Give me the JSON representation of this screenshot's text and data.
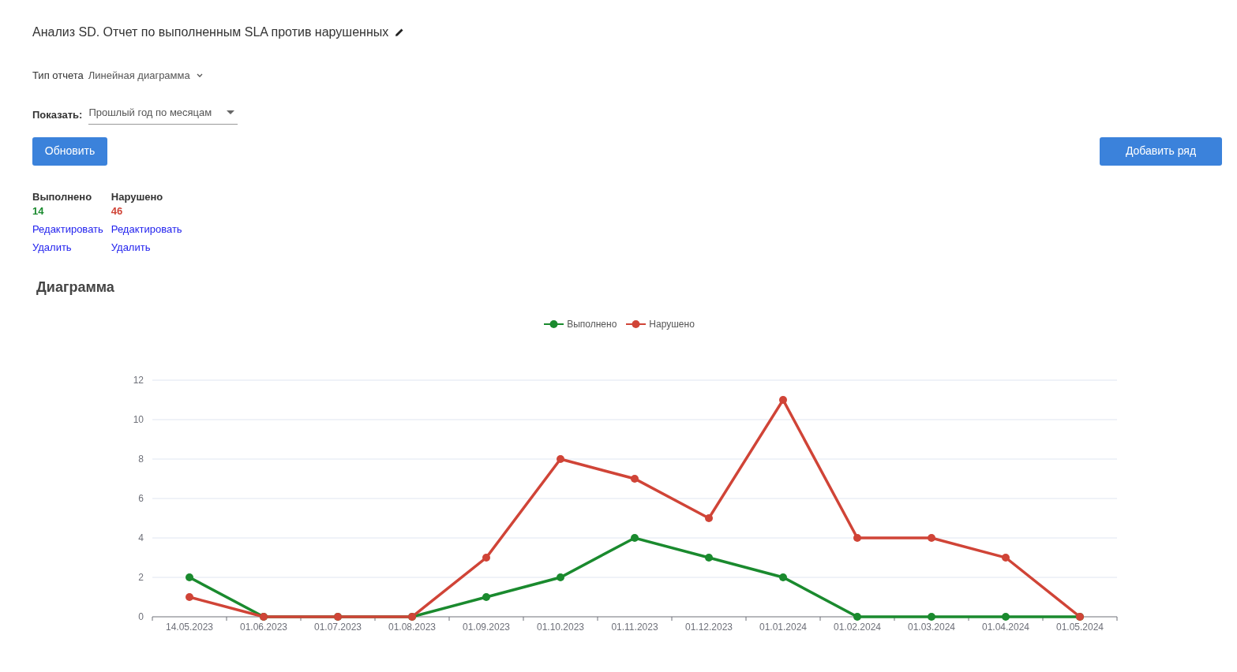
{
  "title": "Анализ SD. Отчет по выполненным SLA против нарушенных",
  "report_type": {
    "label": "Тип отчета",
    "value": "Линейная диаграмма"
  },
  "show": {
    "label": "Показать:",
    "value": "Прошлый год по месяцам"
  },
  "buttons": {
    "refresh": "Обновить",
    "add_series": "Добавить ряд"
  },
  "series_summary": [
    {
      "name": "Выполнено",
      "count": "14",
      "color": "#1a8a2e",
      "edit": "Редактировать",
      "delete": "Удалить"
    },
    {
      "name": "Нарушено",
      "count": "46",
      "color": "#d04437",
      "edit": "Редактировать",
      "delete": "Удалить"
    }
  ],
  "chart_section": {
    "heading": "Диаграмма",
    "chart_data": {
      "type": "line",
      "categories": [
        "14.05.2023",
        "01.06.2023",
        "01.07.2023",
        "01.08.2023",
        "01.09.2023",
        "01.10.2023",
        "01.11.2023",
        "01.12.2023",
        "01.01.2024",
        "01.02.2024",
        "01.03.2024",
        "01.04.2024",
        "01.05.2024"
      ],
      "series": [
        {
          "name": "Выполнено",
          "color": "#1a8a2e",
          "marker": "circle",
          "values": [
            2,
            0,
            0,
            0,
            1,
            2,
            4,
            3,
            2,
            0,
            0,
            0,
            0
          ]
        },
        {
          "name": "Нарушено",
          "color": "#d04437",
          "marker": "circle",
          "values": [
            1,
            0,
            0,
            0,
            3,
            8,
            7,
            5,
            11,
            4,
            4,
            3,
            0
          ]
        }
      ],
      "grid": true,
      "ylim": [
        0,
        12
      ],
      "yticks": [
        0,
        2,
        4,
        6,
        8,
        10,
        12
      ]
    }
  }
}
